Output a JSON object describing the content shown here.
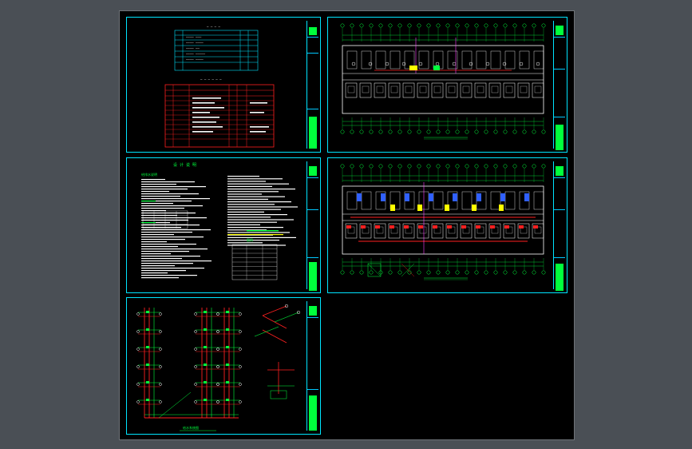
{
  "window": {
    "title": "",
    "background_color": "#4a4f55"
  },
  "sheets": [
    {
      "id": "sheet-1",
      "content": "drawing-list-and-material-table"
    },
    {
      "id": "sheet-2",
      "content": "floor-plan-upper"
    },
    {
      "id": "sheet-3",
      "content": "design-notes"
    },
    {
      "id": "sheet-4",
      "content": "floor-plan-lower"
    },
    {
      "id": "sheet-5",
      "content": "pipe-system-diagram"
    }
  ],
  "colors": {
    "canvas": "#000000",
    "frame": "#00e5ff",
    "text": "#ffffff",
    "green": "#00ff3c",
    "red": "#ff2020",
    "yellow": "#ffff00",
    "magenta": "#ff40ff",
    "blue": "#3060ff"
  },
  "labels": {
    "notes_heading": "设 计 说 明",
    "notes_title_left": "给排水说明",
    "table2_title": "图例",
    "diagram_caption": "给水系统图"
  }
}
